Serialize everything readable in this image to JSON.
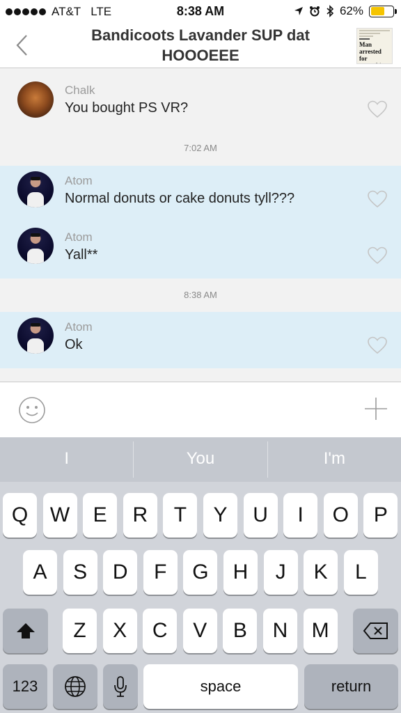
{
  "status_bar": {
    "carrier": "AT&T",
    "network": "LTE",
    "time": "8:38 AM",
    "battery": "62%",
    "battery_level": 0.62
  },
  "header": {
    "title": "Bandicoots Lavander SUP dat HOOOEEE",
    "thumbnail_headline": "Man arrested for everything"
  },
  "messages": [
    {
      "sender": "Chalk",
      "text": "You bought PS VR?",
      "own": false
    },
    {
      "timestamp": "7:02 AM"
    },
    {
      "sender": "Atom",
      "text": "Normal donuts or cake donuts tyll???",
      "own": true
    },
    {
      "sender": "Atom",
      "text": "Yall**",
      "own": true
    },
    {
      "timestamp": "8:38 AM"
    },
    {
      "sender": "Atom",
      "text": "Ok",
      "own": true
    }
  ],
  "predictions": [
    "I",
    "You",
    "I'm"
  ],
  "keyboard": {
    "row1": [
      "Q",
      "W",
      "E",
      "R",
      "T",
      "Y",
      "U",
      "I",
      "O",
      "P"
    ],
    "row2": [
      "A",
      "S",
      "D",
      "F",
      "G",
      "H",
      "J",
      "K",
      "L"
    ],
    "row3": [
      "Z",
      "X",
      "C",
      "V",
      "B",
      "N",
      "M"
    ],
    "numbers_key": "123",
    "space_key": "space",
    "return_key": "return"
  },
  "icons": {
    "back": "chevron-left-icon",
    "heart": "heart-icon",
    "emoji": "smiley-icon",
    "add": "plus-icon",
    "shift": "shift-icon",
    "delete": "backspace-icon",
    "globe": "globe-icon",
    "mic": "microphone-icon"
  },
  "colors": {
    "own_message_bg": "#ddeef7",
    "battery": "#f5c400"
  }
}
